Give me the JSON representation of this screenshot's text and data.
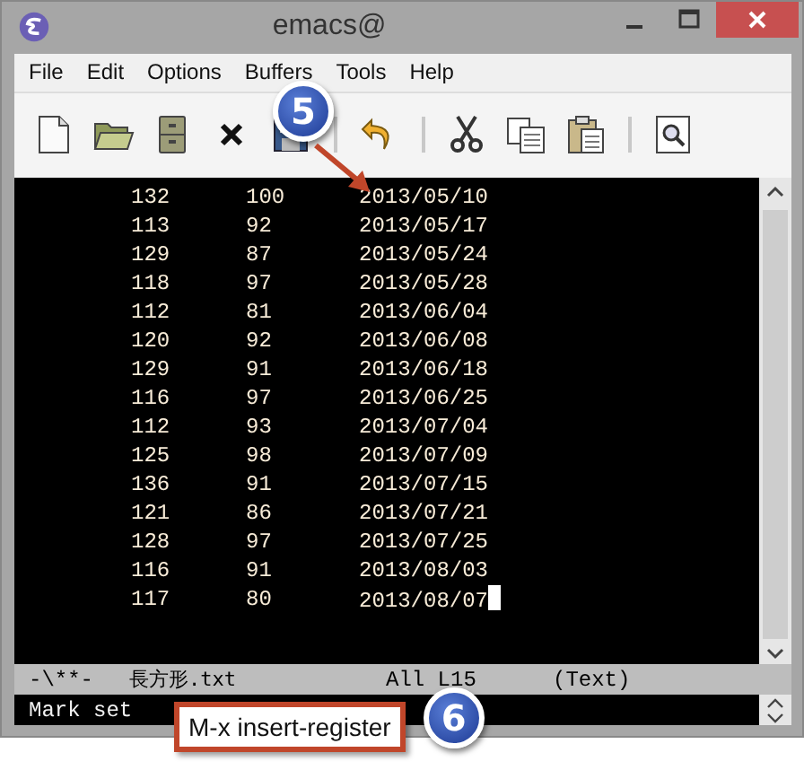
{
  "window": {
    "title": "emacs@"
  },
  "menu": [
    "File",
    "Edit",
    "Options",
    "Buffers",
    "Tools",
    "Help"
  ],
  "toolbar": [
    {
      "kind": "new"
    },
    {
      "kind": "open"
    },
    {
      "kind": "cabinet"
    },
    {
      "kind": "close"
    },
    {
      "kind": "save"
    },
    {
      "kind": "separator"
    },
    {
      "kind": "undo"
    },
    {
      "kind": "separator"
    },
    {
      "kind": "cut"
    },
    {
      "kind": "copy"
    },
    {
      "kind": "paste"
    },
    {
      "kind": "separator"
    },
    {
      "kind": "search"
    }
  ],
  "buffer": {
    "rows": [
      [
        "132",
        "100",
        "2013/05/10"
      ],
      [
        "113",
        "92",
        "2013/05/17"
      ],
      [
        "129",
        "87",
        "2013/05/24"
      ],
      [
        "118",
        "97",
        "2013/05/28"
      ],
      [
        "112",
        "81",
        "2013/06/04"
      ],
      [
        "120",
        "92",
        "2013/06/08"
      ],
      [
        "129",
        "91",
        "2013/06/18"
      ],
      [
        "116",
        "97",
        "2013/06/25"
      ],
      [
        "112",
        "93",
        "2013/07/04"
      ],
      [
        "125",
        "98",
        "2013/07/09"
      ],
      [
        "136",
        "91",
        "2013/07/15"
      ],
      [
        "121",
        "86",
        "2013/07/21"
      ],
      [
        "128",
        "97",
        "2013/07/25"
      ],
      [
        "116",
        "91",
        "2013/08/03"
      ],
      [
        "117",
        "80",
        "2013/08/07"
      ]
    ]
  },
  "mode_line": {
    "status": "-\\**-",
    "buffer_name": "長方形.txt",
    "position": "All L15",
    "mode": "(Text)"
  },
  "minibuffer": "Mark set",
  "callouts": [
    {
      "number": "5"
    },
    {
      "number": "6",
      "label": "M-x insert-register"
    }
  ]
}
